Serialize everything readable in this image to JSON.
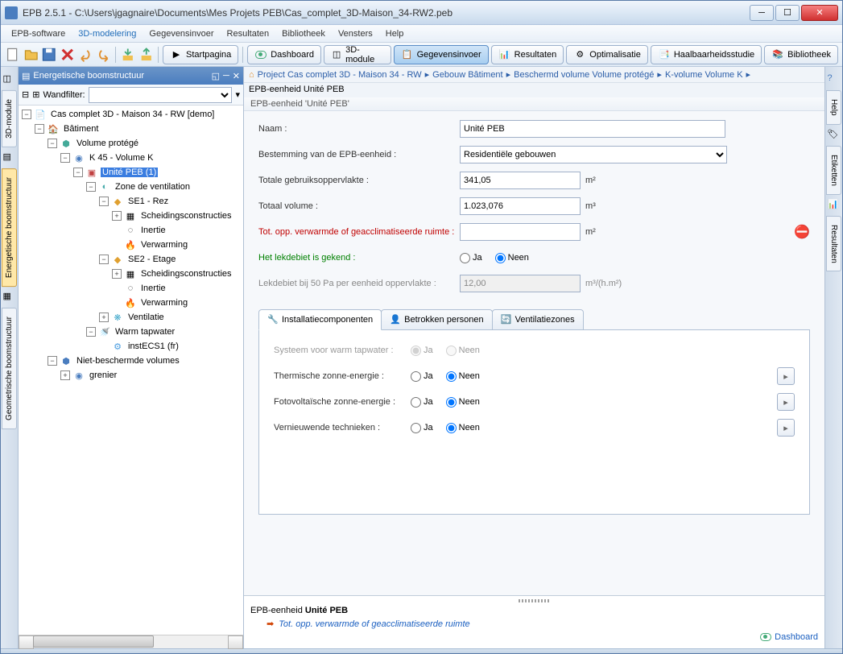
{
  "window": {
    "title": "EPB 2.5.1 - C:\\Users\\jgagnaire\\Documents\\Mes Projets PEB\\Cas_complet_3D-Maison_34-RW2.peb"
  },
  "menubar": {
    "items": [
      "EPB-software",
      "3D-modelering",
      "Gegevensinvoer",
      "Resultaten",
      "Bibliotheek",
      "Vensters",
      "Help"
    ],
    "active_index": 1
  },
  "toolbar": {
    "startpagina": "Startpagina",
    "dashboard": "Dashboard",
    "module3d": "3D-module",
    "gegevensinvoer": "Gegevensinvoer",
    "resultaten": "Resultaten",
    "optimalisatie": "Optimalisatie",
    "haalbaarheidsstudie": "Haalbaarheidsstudie",
    "bibliotheek": "Bibliotheek"
  },
  "left_rail": {
    "tabs": [
      "3D-module",
      "Energetische boomstructuur",
      "Geometrische boomstructuur"
    ],
    "active_index": 1
  },
  "right_rail": {
    "tabs": [
      "Help",
      "Etiketten",
      "Resultaten"
    ]
  },
  "tree": {
    "title": "Energetische boomstructuur",
    "filter_label": "Wandfilter:",
    "filter_value": "",
    "root": "Cas complet 3D - Maison 34 - RW [demo]",
    "nodes": {
      "batiment": "Bâtiment",
      "volume_protege": "Volume protégé",
      "k45": "K 45 - Volume K",
      "unite_peb": "Unité PEB (1)",
      "zone_vent": "Zone de ventilation",
      "se1": "SE1 - Rez",
      "scheid1": "Scheidingsconstructies",
      "inertie1": "Inertie",
      "verw1": "Verwarming",
      "se2": "SE2 - Etage",
      "scheid2": "Scheidingsconstructies",
      "inertie2": "Inertie",
      "verw2": "Verwarming",
      "ventilatie": "Ventilatie",
      "warm_tap": "Warm tapwater",
      "instecs": "instECS1 (fr)",
      "niet_besch": "Niet-beschermde volumes",
      "grenier": "grenier"
    }
  },
  "breadcrumb": {
    "items": [
      "Project Cas complet 3D - Maison 34 - RW",
      "Gebouw Bâtiment",
      "Beschermd volume Volume protégé",
      "K-volume Volume K"
    ]
  },
  "entity_header": "EPB-eenheid Unité PEB",
  "fieldset": "EPB-eenheid 'Unité PEB'",
  "form": {
    "naam_label": "Naam :",
    "naam_value": "Unité PEB",
    "bestemming_label": "Bestemming van de EPB-eenheid :",
    "bestemming_value": "Residentiële gebouwen",
    "totale_opp_label": "Totale gebruiksoppervlakte :",
    "totale_opp_value": "341,05",
    "totaal_vol_label": "Totaal volume :",
    "totaal_vol_value": "1.023,076",
    "tot_opp_verw_label": "Tot. opp. verwarmde of geacclimatiseerde ruimte  :",
    "tot_opp_verw_value": "",
    "lekdebiet_gekend_label": "Het lekdebiet is gekend :",
    "lekdebiet_50pa_label": "Lekdebiet bij 50 Pa per eenheid oppervlakte :",
    "lekdebiet_50pa_value": "12,00",
    "unit_m2": "m²",
    "unit_m3": "m³",
    "unit_m3hm2": "m³/(h.m²)",
    "ja": "Ja",
    "neen": "Neen"
  },
  "subtabs": {
    "installatie": "Installatiecomponenten",
    "betrokken": "Betrokken personen",
    "ventilatie": "Ventilatiezones"
  },
  "subpanel": {
    "systeem_warm_label": "Systeem voor warm tapwater :",
    "thermische_label": "Thermische zonne-energie :",
    "fotovolt_label": "Fotovoltaïsche zonne-energie :",
    "vernieuw_label": "Vernieuwende technieken :"
  },
  "bottom": {
    "title_prefix": "EPB-eenheid ",
    "title_bold": "Unité PEB",
    "warning": "Tot. opp. verwarmde of geacclimatiseerde ruimte",
    "dashboard": "Dashboard"
  }
}
